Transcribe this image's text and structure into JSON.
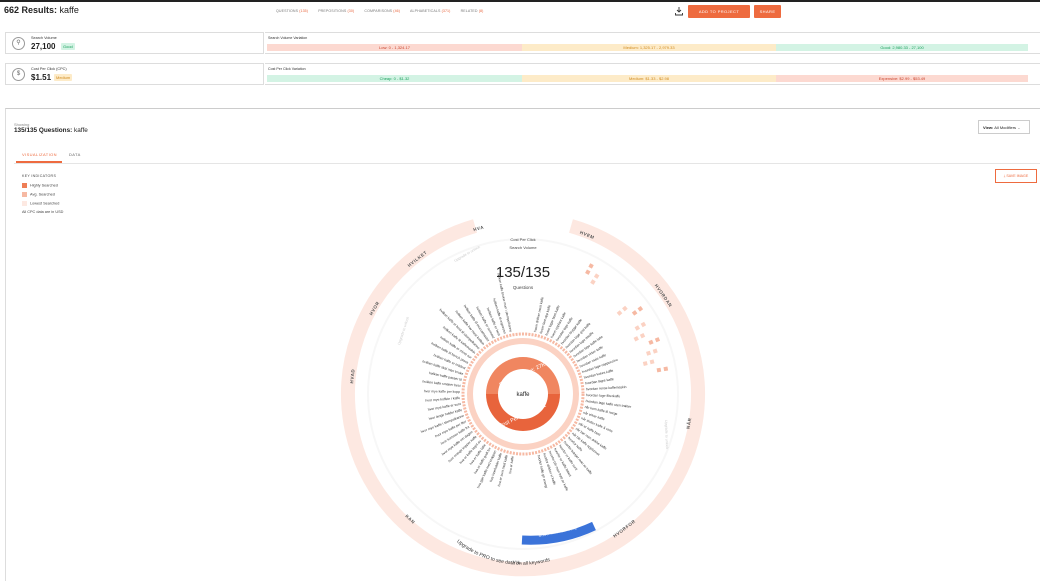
{
  "header": {
    "results_count": "662 Results:",
    "keyword": "kaffe",
    "tabs": [
      {
        "label": "QUESTIONS",
        "count": "(135)"
      },
      {
        "label": "PREPOSITIONS",
        "count": "(30)"
      },
      {
        "label": "COMPARISONS",
        "count": "(46)"
      },
      {
        "label": "ALPHABETICALS",
        "count": "(371)"
      },
      {
        "label": "RELATED",
        "count": "(8)"
      }
    ],
    "add_to_project": "ADD TO PROJECT",
    "share": "SHARE"
  },
  "search_volume": {
    "label": "Search Volume",
    "value": "27,100",
    "badge": "Good",
    "variation_title": "Search Volume Variation",
    "ranges": [
      "Low: 0 - 1,324.17",
      "Medium: 1,325.17 - 2,979.33",
      "Good: 2,980.33 - 27,100"
    ]
  },
  "cpc": {
    "label": "Cost Per Click (CPC)",
    "value": "$1.51",
    "badge": "Medium",
    "variation_title": "Cost Per Click Variation",
    "ranges": [
      "Cheap: 0 - $1.32",
      "Medium: $1.33 - $2.98",
      "Expensive: $2.99 - $53.49"
    ]
  },
  "colors": {
    "accent": "#ee6b3f",
    "good": "#1aa05c",
    "low_bg": "#fcd9d1",
    "med_bg": "#fdebc8",
    "good_bg": "#d3f3e4",
    "blue": "#3b73d9"
  },
  "panel": {
    "showing": "Showing",
    "questions_title": "135/135 Questions:",
    "keyword": "kaffe",
    "view_label": "View:",
    "view_value": "All Modifiers",
    "tabs": [
      "VISUALIZATION",
      "DATA"
    ],
    "key_indicators": "KEY INDICATORS",
    "legend": [
      "Highly Searched",
      "Avg. Searched",
      "Lowest Searched"
    ],
    "cpc_note": "All CPC data are in USD",
    "save_image": "SAVE IMAGE"
  },
  "wheel": {
    "cpc_label": "Cost Per Click",
    "sv_label": "Search Volume",
    "count": "135/135",
    "count_label": "Questions",
    "center": "kaffe",
    "inner_top": "Search Volume: 27K",
    "inner_bottom": "Cost Per Click: $1.51",
    "modifiers": [
      "HVEM",
      "HVORDAN",
      "NÅR",
      "HVORFOR",
      "VIL",
      "KAN",
      "HVAD",
      "HVOR",
      "HVILKET",
      "HVA"
    ],
    "upgrade_text": "Upgrade to PRO to see data on all keywords",
    "upgrade_small": "Upgrade to unlock",
    "trial": "START MY FREE TRIAL",
    "left_questions": [
      "hvilken kaffe bruker man i stempelkanne",
      "hvilken kaffe til espresso",
      "hvilken kaffe er best",
      "hvilken kaffe er sunnest",
      "hvilken kaffe til moccamaster",
      "hvilken kaffe har mest koffein",
      "hvilken kaffe er best til stempelkanne",
      "hvilken kaffe til kaffemaskin",
      "hvilken kaffe er minst sur",
      "hvilken kaffe til french press",
      "hvilken kaffe er mildest",
      "hvilken kaffe skal man bruke",
      "hvilken kaffe passer til",
      "hvilken kaffe smaker best",
      "hvor mye kaffe per kopp",
      "hvor mye koffein i kaffe",
      "hvor mye kaffe er sunt",
      "hvor lenge holder kaffe",
      "hvor mye kaffe i stempelkanne",
      "hvor mye kaffe per liter",
      "hvor kommer kaffe fra",
      "hvor mye kaffe om dagen",
      "hvor mange kopper kaffe",
      "hva er kaffe laget av",
      "hva er kaffe latte",
      "hva er kaffe godt for",
      "hva gjør kaffe med kroppen",
      "hva inneholder kaffe",
      "hva er sunt med kaffe",
      "hva er kaffe"
    ],
    "right_questions": [
      "hvem drikker mest kaffe",
      "hvem fant opp kaffe",
      "hvem lager best kaffe",
      "hvem oppfant kaffe",
      "hvordan lage kaffe",
      "hvordan brygge kaffe",
      "hvordan lage god kaffe",
      "hvordan lage iskaffe",
      "hvordan lage kaffe latte",
      "hvordan virker kaffe",
      "hvordan male kaffe",
      "hvordan lage cappuccino",
      "hvordan kokes kaffe",
      "hvordan lagre kaffe",
      "hvordan rense kaffemaskin",
      "hvordan lage filterkaffe",
      "hvordan lage kaffe uten trakter",
      "når kom kaffe til norge",
      "når virker kaffe",
      "når slutter kaffe å virke",
      "når er kaffe best",
      "når bør man drikke kaffe",
      "når ble kaffe oppfunnet",
      "hvorfor kaffe",
      "hvorfor bæsjer man av kaffe",
      "hvorfor er kaffe sunt",
      "hvorfor er kaffe bittert",
      "hvorfor blir man trøtt av kaffe",
      "hvorfor drikker vi kaffe",
      "hvorfor kaffe gir energi"
    ]
  }
}
